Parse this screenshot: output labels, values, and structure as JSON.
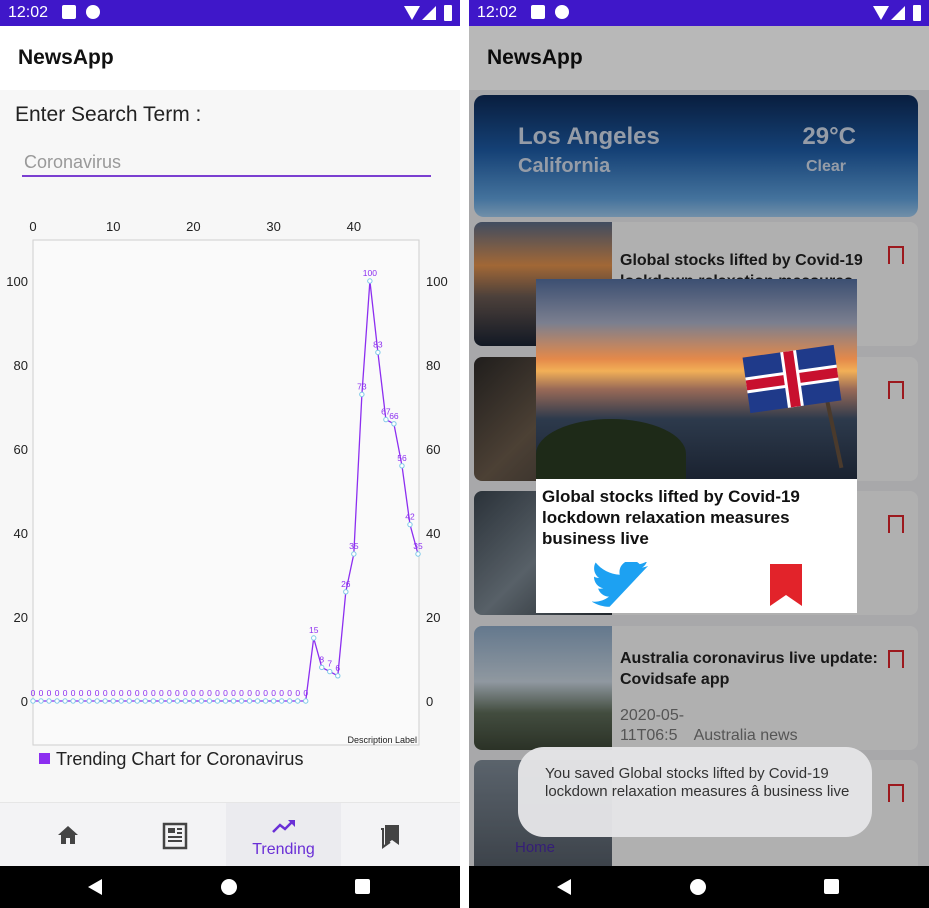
{
  "left": {
    "status_time": "12:02",
    "app_title": "NewsApp",
    "search_label": "Enter Search Term :",
    "search_value": "Coronavirus",
    "legend_label": "Trending Chart for Coronavirus",
    "description_label": "Description Label",
    "nav": {
      "trending_label": "Trending"
    },
    "icons": [
      "home-icon",
      "newspaper-icon",
      "trending-up-icon",
      "bookmarks-icon"
    ]
  },
  "chart_data": {
    "type": "line",
    "x": [
      0,
      1,
      2,
      3,
      4,
      5,
      6,
      7,
      8,
      9,
      10,
      11,
      12,
      13,
      14,
      15,
      16,
      17,
      18,
      19,
      20,
      21,
      22,
      23,
      24,
      25,
      26,
      27,
      28,
      29,
      30,
      31,
      32,
      33,
      34,
      35,
      36,
      37,
      38,
      39,
      40,
      41,
      42,
      43,
      44,
      45,
      46,
      47,
      48
    ],
    "series": [
      {
        "values": [
          0,
          0,
          0,
          0,
          0,
          0,
          0,
          0,
          0,
          0,
          0,
          0,
          0,
          0,
          0,
          0,
          0,
          0,
          0,
          0,
          0,
          0,
          0,
          0,
          0,
          0,
          0,
          0,
          0,
          0,
          0,
          0,
          0,
          0,
          0,
          15,
          8,
          7,
          6,
          26,
          35,
          73,
          100,
          83,
          67,
          66,
          56,
          42,
          35
        ]
      }
    ],
    "xticks": [
      0,
      10,
      20,
      30,
      40
    ],
    "yticks": [
      0,
      20,
      40,
      60,
      80,
      100
    ],
    "xlim": [
      0,
      48
    ],
    "ylim": [
      0,
      110
    ],
    "x_axis_position": "top",
    "y_axis_both_sides": true,
    "colors": {
      "line": "#8c2ef0",
      "point": "#7ec9e8",
      "value_label": "#8c2ef0"
    },
    "legend": "bottom-left",
    "grid": false
  },
  "right": {
    "status_time": "12:02",
    "app_title": "NewsApp",
    "weather": {
      "city": "Los Angeles",
      "region": "California",
      "temp": "29°C",
      "condition": "Clear"
    },
    "cards": [
      {
        "headline": "Global stocks lifted by Covid-19 lockdown relaxation measures"
      },
      {
        "headline": ""
      },
      {
        "headline": ""
      },
      {
        "headline": "Australia coronavirus live update: Covidsafe app",
        "date": "2020-05-11T06:5",
        "section": "Australia news"
      },
      {
        "headline": ""
      }
    ],
    "popup": {
      "headline": "Global stocks lifted by Covid-19 lockdown relaxation measures business live"
    },
    "toast": "You saved Global stocks lifted by Covid-19 lockdown relaxation measures â business live",
    "nav": {
      "home_label": "Home"
    },
    "colors": {
      "accent": "#3f17c9",
      "bookmark": "#e2232a",
      "twitter": "#1da1f2"
    }
  }
}
